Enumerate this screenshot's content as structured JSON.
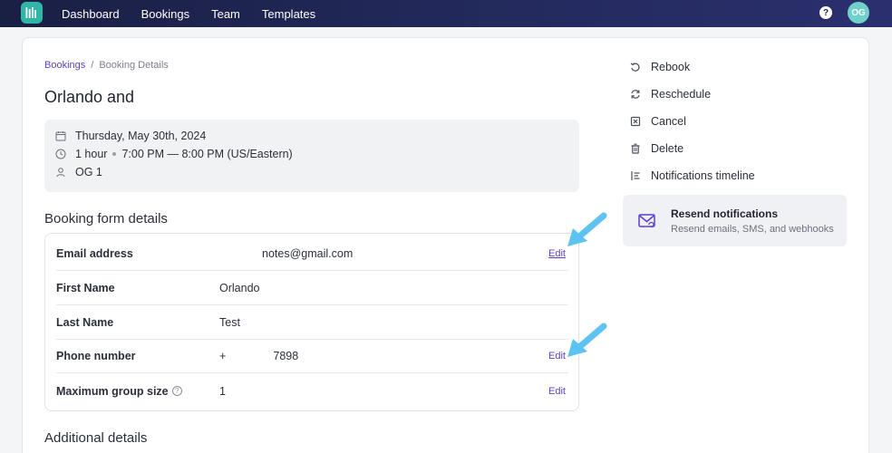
{
  "nav": {
    "items": [
      "Dashboard",
      "Bookings",
      "Team",
      "Templates"
    ],
    "help": "?",
    "avatar_initials": "OG"
  },
  "breadcrumb": {
    "parent": "Bookings",
    "separator": "/",
    "current": "Booking Details"
  },
  "booking": {
    "title": "Orlando and",
    "date": "Thursday, May 30th, 2024",
    "duration": "1 hour",
    "time": "7:00 PM — 8:00 PM (US/Eastern)",
    "host": "OG 1"
  },
  "form_section": {
    "title": "Booking form details",
    "rows": [
      {
        "label": "Email address",
        "value": "notes@gmail.com",
        "edit": "Edit"
      },
      {
        "label": "First Name",
        "value": "Orlando",
        "edit": ""
      },
      {
        "label": "Last Name",
        "value": "Test",
        "edit": ""
      },
      {
        "label": "Phone number",
        "value": "+               7898",
        "edit": "Edit"
      },
      {
        "label": "Maximum group size",
        "value": "1",
        "edit": "Edit"
      }
    ]
  },
  "additional_section": {
    "title": "Additional details"
  },
  "actions": {
    "items": [
      {
        "label": "Rebook",
        "icon": "rebook-icon"
      },
      {
        "label": "Reschedule",
        "icon": "reschedule-icon"
      },
      {
        "label": "Cancel",
        "icon": "cancel-icon"
      },
      {
        "label": "Delete",
        "icon": "trash-icon"
      },
      {
        "label": "Notifications timeline",
        "icon": "timeline-icon"
      }
    ],
    "resend": {
      "title": "Resend notifications",
      "subtitle": "Resend emails, SMS, and webhooks"
    }
  },
  "colors": {
    "accent": "#5b3fd6",
    "nav_bg": "#1d2350",
    "logo": "#2fb6a6",
    "avatar": "#6fd1c8",
    "arrow": "#5cc3f2"
  }
}
